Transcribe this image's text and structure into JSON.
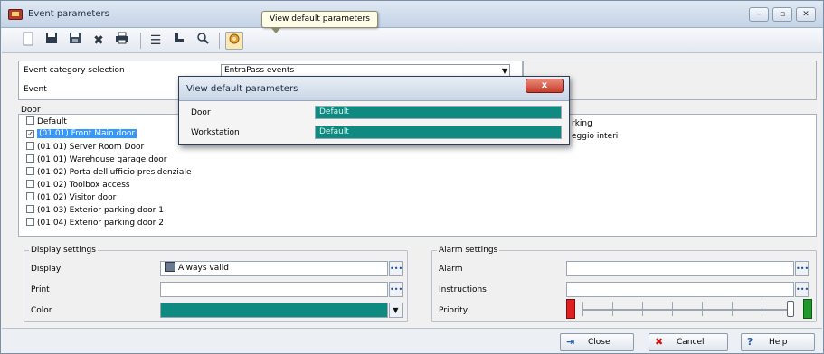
{
  "window": {
    "title": "Event parameters",
    "controls": [
      "–",
      "▫",
      "✕"
    ]
  },
  "tooltip": {
    "text": "View default parameters"
  },
  "toolbar": {
    "icons": [
      "new-icon",
      "save-icon",
      "save-as-icon",
      "delete-icon",
      "print-icon",
      "list-icon",
      "link-icon",
      "search-icon",
      "default-params-icon"
    ]
  },
  "top_panel": {
    "event_category_label": "Event category selection",
    "event_category_value": "EntraPass events",
    "event_label": "Event"
  },
  "door_list": {
    "label": "Door",
    "items": [
      {
        "label": "Default",
        "checked": false,
        "selected": false
      },
      {
        "label": "(01.01) Front Main door",
        "checked": true,
        "selected": true
      },
      {
        "label": "(01.01) Server Room Door",
        "checked": false,
        "selected": false
      },
      {
        "label": "(01.01) Warehouse garage door",
        "checked": false,
        "selected": false
      },
      {
        "label": "(01.02) Porta dell'ufficio presidenziale",
        "checked": false,
        "selected": false
      },
      {
        "label": "(01.02) Toolbox access",
        "checked": false,
        "selected": false
      },
      {
        "label": "(01.02) Visitor door",
        "checked": false,
        "selected": false
      },
      {
        "label": "(01.03) Exterior parking door 1",
        "checked": false,
        "selected": false
      },
      {
        "label": "(01.04) Exterior parking door 2",
        "checked": false,
        "selected": false
      }
    ]
  },
  "right_list": {
    "items": [
      "rking",
      "eggio interi"
    ]
  },
  "display_settings": {
    "title": "Display settings",
    "display_label": "Display",
    "display_value": "Always valid",
    "print_label": "Print",
    "print_value": "",
    "color_label": "Color",
    "color_value": "#0e8a80"
  },
  "alarm_settings": {
    "title": "Alarm settings",
    "alarm_label": "Alarm",
    "alarm_value": "",
    "instructions_label": "Instructions",
    "instructions_value": "",
    "priority_label": "Priority",
    "priority_level": 1.0
  },
  "dialog": {
    "title": "View default parameters",
    "close_label": "x",
    "rows": [
      {
        "label": "Door",
        "value": "Default"
      },
      {
        "label": "Workstation",
        "value": "Default"
      }
    ],
    "value_color": "#0e8a80"
  },
  "buttons": {
    "close": "Close",
    "cancel": "Cancel",
    "help": "Help"
  },
  "colors": {
    "accent_teal": "#0e8a80",
    "selection_blue": "#3399ff",
    "priority_low": "#e02020",
    "priority_high": "#1f9a2a"
  }
}
